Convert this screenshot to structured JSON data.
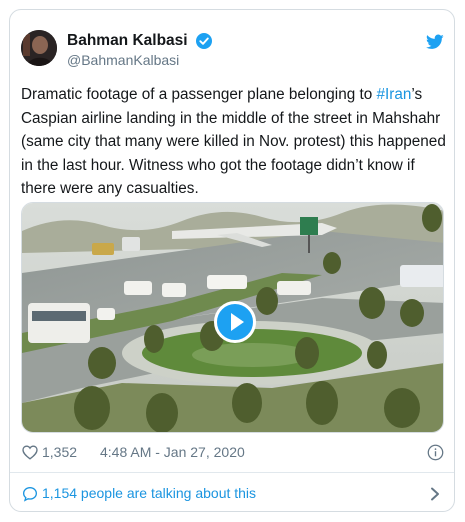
{
  "author": {
    "name": "Bahman Kalbasi",
    "handle": "@BahmanKalbasi",
    "verified": true
  },
  "tweet": {
    "text_before_hashtag": "Dramatic footage of a passenger plane belonging to ",
    "hashtag": "#Iran",
    "text_after_hashtag": "’s Caspian airline landing in the middle of the street in Mahshahr (same city that many were killed in Nov. protest) this happened in the last hour. Witness who got the footage didn’t know if there were any casualties."
  },
  "media": {
    "type": "video",
    "play_icon": "play-icon"
  },
  "stats": {
    "likes": "1,352",
    "timestamp": "4:48 AM - Jan 27, 2020"
  },
  "conversation": {
    "label": "1,154 people are talking about this"
  },
  "colors": {
    "accent": "#1da1f2",
    "link": "#1b95e0",
    "muted": "#657786",
    "text": "#14171a",
    "border": "#d5dce1"
  },
  "icons": {
    "verified": "verified-badge-icon",
    "brand": "twitter-bird-icon",
    "like": "heart-icon",
    "info": "info-icon",
    "reply": "speech-bubble-icon",
    "more": "chevron-right-icon"
  }
}
